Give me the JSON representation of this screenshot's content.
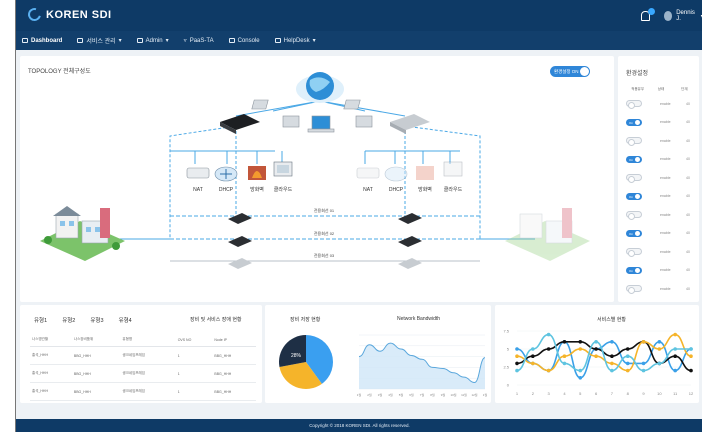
{
  "app": {
    "brand": "KOREN SDI",
    "user": "Dennis J."
  },
  "nav": [
    {
      "label": "Dashboard",
      "active": true
    },
    {
      "label": "서비스 관리"
    },
    {
      "label": "Admin"
    },
    {
      "label": "PaaS-TA"
    },
    {
      "label": "Console"
    },
    {
      "label": "HelpDesk"
    }
  ],
  "topology": {
    "title": "TOPOLOGY 전체구성도",
    "toggle_label": "환경설정 ON",
    "devices_left": [
      "NAT",
      "DHCP",
      "방화벽",
      "클라우드"
    ],
    "devices_right": [
      "NAT",
      "DHCP",
      "방화벽",
      "클라우드"
    ],
    "links": [
      "전용회선 01",
      "전용회선 02",
      "전용회선 03"
    ]
  },
  "env": {
    "title": "환경설정",
    "headers": [
      "적용유무",
      "상태",
      "단계"
    ],
    "rows": [
      {
        "state": "Off",
        "status": "enable",
        "value": "40"
      },
      {
        "state": "On",
        "status": "enable",
        "value": "40"
      },
      {
        "state": "Off",
        "status": "enable",
        "value": "40"
      },
      {
        "state": "On",
        "status": "enable",
        "value": "40"
      },
      {
        "state": "Off",
        "status": "enable",
        "value": "40"
      },
      {
        "state": "On",
        "status": "enable",
        "value": "40"
      },
      {
        "state": "Off",
        "status": "enable",
        "value": "40"
      },
      {
        "state": "On",
        "status": "enable",
        "value": "40"
      },
      {
        "state": "Off",
        "status": "enable",
        "value": "40"
      },
      {
        "state": "On",
        "status": "enable",
        "value": "40"
      },
      {
        "state": "Off",
        "status": "enable",
        "value": "40"
      }
    ],
    "colors": {
      "on": "#2f86d8",
      "off": "#f3f5f7"
    }
  },
  "faults": {
    "tabs": [
      "유형1",
      "유형2",
      "유형3",
      "유형4"
    ],
    "title": "장비 및 서비스 장애 현황",
    "columns": [
      "나스명관할",
      "나스장비품위",
      "유형명",
      "OVS NO",
      "Node IP"
    ],
    "rows": [
      [
        "홍석_HHH",
        "BBG_HHH",
        "생크네임프레임",
        "1",
        "BBG_HHH"
      ],
      [
        "홍석_HHH",
        "BBG_HHH",
        "생크네임프레임",
        "1",
        "BBG_HHH"
      ],
      [
        "홍석_HHH",
        "BBG_HHH",
        "생크네임프레임",
        "1",
        "BBG_HHH"
      ]
    ]
  },
  "status": {
    "title": "장비 저장 현황",
    "bandwidth_title": "Network Bandwidth",
    "pie": [
      {
        "value": 40,
        "color": "#3a9ff0"
      },
      {
        "value": 32,
        "color": "#f5b42a"
      },
      {
        "value": 28,
        "color": "#1e2f45"
      }
    ],
    "pie_labels": [
      "28%"
    ],
    "bandwidth_values": [
      60,
      82,
      70,
      85,
      74,
      62,
      55,
      40,
      38,
      30,
      22,
      12,
      58
    ],
    "bandwidth_x": [
      "1월",
      "2월",
      "3월",
      "4월",
      "5월",
      "6월",
      "7월",
      "8월",
      "9월",
      "10월",
      "11월",
      "12월",
      "1월"
    ]
  },
  "chart_data": {
    "type": "line",
    "title": "서비스별 현황",
    "x": [
      1,
      2,
      3,
      4,
      5,
      6,
      7,
      8,
      9,
      10,
      11,
      12
    ],
    "ylim": [
      0,
      7.5
    ],
    "yticks": [
      "0",
      "2.5",
      "5",
      "7.5"
    ],
    "series": [
      {
        "color": "#3aa0e8",
        "values": [
          5,
          3,
          2,
          6,
          1,
          5,
          6,
          3,
          3,
          6,
          2,
          5
        ]
      },
      {
        "color": "#111111",
        "values": [
          3,
          4,
          5,
          6,
          6,
          5,
          4,
          5,
          6,
          3,
          4,
          2
        ]
      },
      {
        "color": "#f5b42a",
        "values": [
          4,
          3,
          2,
          4,
          5,
          4,
          3,
          2,
          6,
          5,
          7,
          4
        ]
      },
      {
        "color": "#5ec4e0",
        "values": [
          2,
          5,
          7,
          3,
          2,
          6,
          2,
          4,
          2,
          3,
          5,
          5
        ]
      }
    ]
  },
  "footer": "Copyright © 2018 KOREN SDI. All rights reserved."
}
